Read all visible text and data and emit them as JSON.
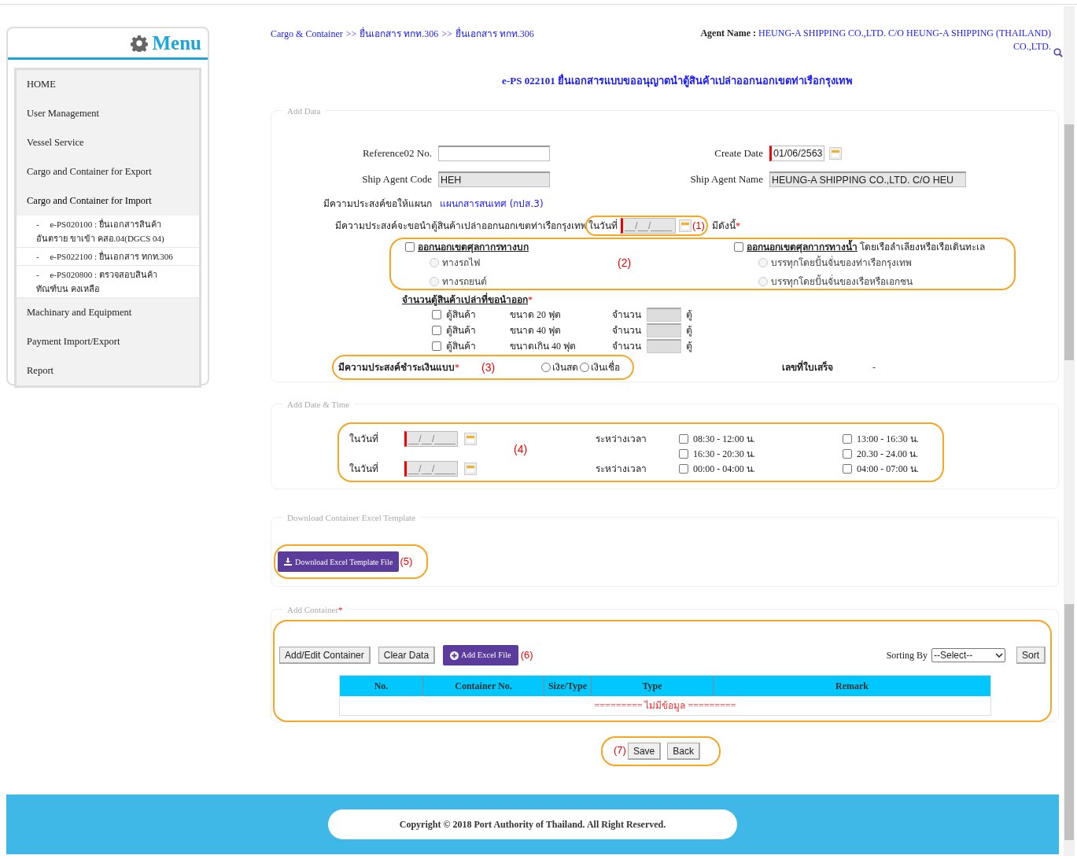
{
  "sidebar": {
    "title": "Menu",
    "items": [
      {
        "label": "HOME",
        "expanded": false
      },
      {
        "label": "User Management",
        "expanded": false
      },
      {
        "label": "Vessel Service",
        "expanded": false
      },
      {
        "label": "Cargo and Container for Export",
        "expanded": false
      },
      {
        "label": "Cargo and Container for Import",
        "expanded": true,
        "children": [
          {
            "marker": "-",
            "label": "e-PS020100 : ยื่นเอกสารสินค้าอันตราย ขาเข้า คสอ.04(DGCS 04)"
          },
          {
            "marker": "-",
            "label": "e-PS022100 : ยื่นเอกสาร ทกท.306"
          },
          {
            "marker": "-",
            "label": "e-PS020800 : ตรวจสอบสินค้าทัณฑ์บน คงเหลือ"
          }
        ]
      },
      {
        "label": "Machinary and Equipment",
        "expanded": false
      },
      {
        "label": "Payment Import/Export",
        "expanded": false
      },
      {
        "label": "Report",
        "expanded": false
      }
    ]
  },
  "breadcrumb": {
    "separator": ">>",
    "items": [
      "Cargo & Container",
      "ยื่นเอกสาร ทกท.306",
      "ยื่นเอกสาร ทกท.306"
    ]
  },
  "agent": {
    "label": "Agent Name :",
    "value": "HEUNG-A SHIPPING CO.,LTD. C/O HEUNG-A SHIPPING (THAILAND) CO.,LTD."
  },
  "page_title": "e-PS 022101 ยื่นเอกสารแบบขออนุญาตนำตู้สินค้าเปล่าออกนอกเขตท่าเรือกรุงเทพ",
  "add_data": {
    "legend": "Add Data",
    "reference": {
      "label": "Reference02 No."
    },
    "create_date": {
      "label": "Create Date",
      "value": "01/06/2563"
    },
    "ship_agent_code": {
      "label": "Ship Agent Code",
      "value": "HEH"
    },
    "ship_agent_name": {
      "label": "Ship Agent Name",
      "value": "HEUNG-A SHIPPING CO.,LTD. C/O HEU"
    },
    "department": {
      "label": "มีความประสงค์ขอให้แผนก",
      "value": "แผนกสารสนเทศ (กปส.3)"
    },
    "purpose": {
      "label": "มีความประสงค์จะขอนำตู้สินค้าเปล่าออกนอกเขตท่าเรือกรุงเทพ",
      "date_label": "ในวันที่",
      "placeholder": "__/__/____",
      "annotation": "(1)",
      "suffix": "มีดังนี้",
      "required": "*"
    },
    "exit_options": {
      "annotation": "(2)",
      "groups": [
        {
          "label": "ออกนอกเขตศุลกากรทางบก",
          "checked": false,
          "options": [
            {
              "label": "ทางรถไฟ",
              "selected": false,
              "disabled": true
            },
            {
              "label": "ทางรถยนต์",
              "selected": false,
              "disabled": true
            }
          ]
        },
        {
          "label": "ออกนอกเขตศุลกากรทางน้ำ",
          "note": "โดยเรือลำเลียงหรือเรือเดินทะเล",
          "checked": false,
          "options": [
            {
              "label": "บรรทุกโดยปั้นจั่นของท่าเรือกรุงเทพ",
              "selected": false,
              "disabled": true
            },
            {
              "label": "บรรทุกโดยปั้นจั่นของเรือหรือเอกชน",
              "selected": false,
              "disabled": true
            }
          ]
        }
      ]
    },
    "containers": {
      "title": "จำนวนตู้สินค้าเปล่าที่ขอนำออก",
      "required": "*",
      "rows": [
        {
          "label": "ตู้สินค้า",
          "size": "ขนาด 20 ฟุต",
          "qty_label": "จำนวน",
          "unit": "ตู้",
          "checked": false
        },
        {
          "label": "ตู้สินค้า",
          "size": "ขนาด 40 ฟุต",
          "qty_label": "จำนวน",
          "unit": "ตู้",
          "checked": false
        },
        {
          "label": "ตู้สินค้า",
          "size": "ขนาดเกิน 40 ฟุต",
          "qty_label": "จำนวน",
          "unit": "ตู้",
          "checked": false
        }
      ]
    },
    "payment": {
      "label": "มีความประสงค์ชำระเงินแบบ",
      "required": "*",
      "annotation": "(3)",
      "options": [
        {
          "label": "เงินสด",
          "selected": false
        },
        {
          "label": "เงินเชื่อ",
          "selected": false
        }
      ]
    },
    "receipt": {
      "label": "เลขที่ใบเสร็จ",
      "value": "-"
    }
  },
  "date_time": {
    "legend": "Add Date & Time",
    "annotation": "(4)",
    "dates": [
      {
        "label": "ในวันที่",
        "placeholder": "__/__/____",
        "time_label": "ระหว่างเวลา"
      },
      {
        "label": "ในวันที่",
        "placeholder": "__/__/____",
        "time_label": "ระหว่างเวลา"
      }
    ],
    "slots": [
      {
        "label": "08:30 - 12:00 น.",
        "checked": false
      },
      {
        "label": "13:00 - 16:30 น.",
        "checked": false
      },
      {
        "label": "16:30 - 20:30 น.",
        "checked": false
      },
      {
        "label": "20.30 - 24.00 น.",
        "checked": false
      },
      {
        "label": "00:00 - 04:00 น.",
        "checked": false
      },
      {
        "label": "04:00 - 07:00 น.",
        "checked": false
      }
    ]
  },
  "download": {
    "legend": "Download Container Excel Template",
    "button": "Download Excel Template File",
    "annotation": "(5)"
  },
  "add_container": {
    "legend": "Add Container",
    "required": "*",
    "annotation": "(6)",
    "buttons": [
      {
        "label": "Add/Edit Container",
        "kind": "plain"
      },
      {
        "label": "Clear Data",
        "kind": "plain"
      },
      {
        "label": "Add Excel File",
        "kind": "primary"
      }
    ],
    "sorting": {
      "label": "Sorting By",
      "value": "--Select--",
      "button": "Sort"
    },
    "table": {
      "columns": [
        "No.",
        "Container No.",
        "Size/Type",
        "Type",
        "Remark"
      ],
      "empty": "========= ไม่มีข้อมูล ========="
    }
  },
  "actions": {
    "annotation": "(7)",
    "buttons": [
      "Save",
      "Back"
    ]
  },
  "footer": "Copyright © 2018 Port Authority of Thailand. All Right Reserved."
}
